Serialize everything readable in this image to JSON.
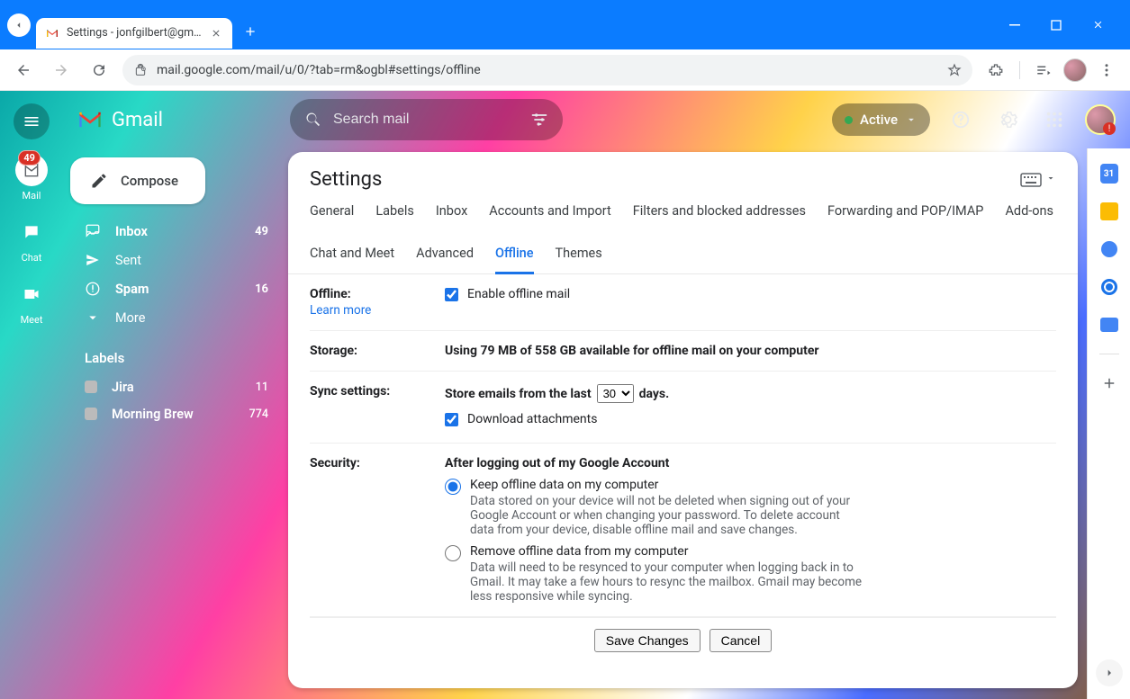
{
  "browser": {
    "tab_title": "Settings - jonfgilbert@gmail.co",
    "url": "mail.google.com/mail/u/0/?tab=rm&ogbl#settings/offline"
  },
  "header": {
    "brand": "Gmail",
    "search_placeholder": "Search mail",
    "status_label": "Active"
  },
  "leftrail": {
    "mail": {
      "label": "Mail",
      "badge": "49"
    },
    "chat": {
      "label": "Chat"
    },
    "meet": {
      "label": "Meet"
    }
  },
  "sidebar": {
    "compose": "Compose",
    "items": [
      {
        "label": "Inbox",
        "count": "49",
        "bold": true
      },
      {
        "label": "Sent",
        "count": ""
      },
      {
        "label": "Spam",
        "count": "16",
        "bold": true
      },
      {
        "label": "More",
        "count": ""
      }
    ],
    "labels_heading": "Labels",
    "labels": [
      {
        "label": "Jira",
        "count": "11"
      },
      {
        "label": "Morning Brew",
        "count": "774"
      }
    ]
  },
  "settings": {
    "title": "Settings",
    "tabs": [
      "General",
      "Labels",
      "Inbox",
      "Accounts and Import",
      "Filters and blocked addresses",
      "Forwarding and POP/IMAP",
      "Add-ons",
      "Chat and Meet",
      "Advanced",
      "Offline",
      "Themes"
    ],
    "active_tab": "Offline",
    "offline": {
      "label": "Offline:",
      "learn_more": "Learn more",
      "checkbox_label": "Enable offline mail",
      "checked": true
    },
    "storage": {
      "label": "Storage:",
      "text": "Using 79 MB of 558 GB available for offline mail on your computer"
    },
    "sync": {
      "label": "Sync settings:",
      "prefix": "Store emails from the last",
      "value": "30",
      "suffix": "days.",
      "download_label": "Download attachments",
      "download_checked": true
    },
    "security": {
      "label": "Security:",
      "heading": "After logging out of my Google Account",
      "opt1_title": "Keep offline data on my computer",
      "opt1_desc": "Data stored on your device will not be deleted when signing out of your Google Account or when changing your password. To delete account data from your device, disable offline mail and save changes.",
      "opt2_title": "Remove offline data from my computer",
      "opt2_desc": "Data will need to be resynced to your computer when logging back in to Gmail. It may take a few hours to resync the mailbox. Gmail may become less responsive while syncing."
    },
    "buttons": {
      "save": "Save Changes",
      "cancel": "Cancel"
    }
  },
  "rightrail": {
    "calendar_day": "31"
  }
}
